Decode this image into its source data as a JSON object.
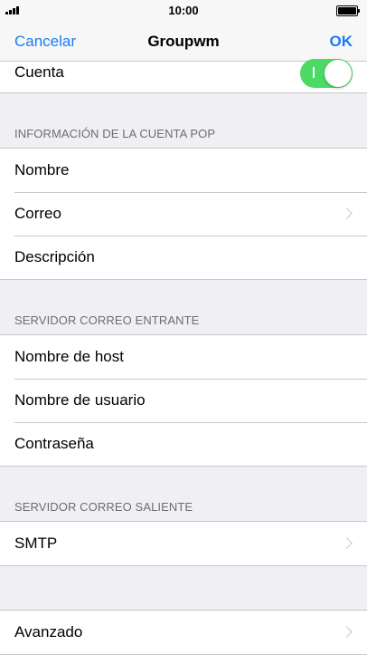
{
  "status_bar": {
    "time": "10:00"
  },
  "nav": {
    "cancel_label": "Cancelar",
    "title": "Groupwm",
    "ok_label": "OK"
  },
  "account_toggle": {
    "label": "Cuenta",
    "on": true,
    "color": "#4cd964"
  },
  "pop_section": {
    "header": "INFORMACIÓN DE LA CUENTA POP",
    "rows": [
      {
        "label": "Nombre"
      },
      {
        "label": "Correo"
      },
      {
        "label": "Descripción"
      }
    ]
  },
  "incoming_section": {
    "header": "SERVIDOR CORREO ENTRANTE",
    "rows": [
      {
        "label": "Nombre de host"
      },
      {
        "label": "Nombre de usuario"
      },
      {
        "label": "Contraseña"
      }
    ]
  },
  "outgoing_section": {
    "header": "SERVIDOR CORREO SALIENTE",
    "rows": [
      {
        "label": "SMTP"
      }
    ]
  },
  "advanced": {
    "label": "Avanzado"
  },
  "colors": {
    "accent": "#1a7cf5",
    "background": "#efeff4",
    "separator": "#c8c7cc"
  }
}
